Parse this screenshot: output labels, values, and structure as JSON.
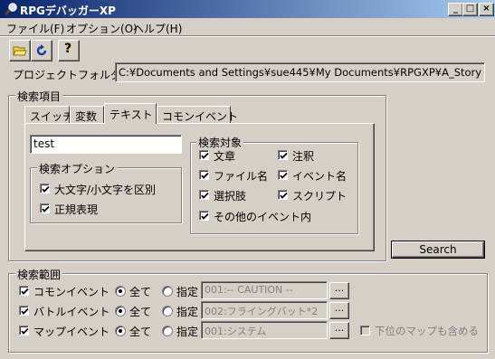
{
  "window": {
    "title": "RPGデバッガーXP",
    "buttons": {
      "minimize": "_",
      "maximize": "□",
      "close": "×"
    }
  },
  "menu": [
    "ファイル(F)",
    "オプション(O)",
    "ヘルプ(H)"
  ],
  "toolbar": {
    "icons": [
      "folder-open-icon",
      "refresh-icon",
      "help-icon"
    ],
    "help_label": "?"
  },
  "project": {
    "label": "プロジェクトフォルダ",
    "path": "C:¥Documents and Settings¥sue445¥My Documents¥RPGXP¥A_Story"
  },
  "search_items": {
    "title": "検索項目",
    "tabs": [
      "スイッチ",
      "変数",
      "テキスト",
      "コモンイベント"
    ],
    "active_tab": "テキスト",
    "query": "test",
    "options": {
      "title": "検索オプション",
      "items": [
        {
          "label": "大文字/小文字を区別",
          "checked": true
        },
        {
          "label": "正規表現",
          "checked": true
        }
      ]
    },
    "targets": {
      "title": "検索対象",
      "items": [
        {
          "label": "文章",
          "checked": true
        },
        {
          "label": "注釈",
          "checked": true
        },
        {
          "label": "ファイル名",
          "checked": true
        },
        {
          "label": "イベント名",
          "checked": true
        },
        {
          "label": "選択肢",
          "checked": true
        },
        {
          "label": "スクリプト",
          "checked": true
        },
        {
          "label": "その他のイベント内",
          "checked": true
        }
      ]
    }
  },
  "search_button": "Search",
  "search_range": {
    "title": "検索範囲",
    "all_label": "全て",
    "specify_label": "指定",
    "browse_label": "...",
    "rows": [
      {
        "label": "コモンイベント",
        "checked": true,
        "mode": "all",
        "value": "001:-- CAUTION --"
      },
      {
        "label": "バトルイベント",
        "checked": true,
        "mode": "all",
        "value": "002:フライングバット*2"
      },
      {
        "label": "マップイベント",
        "checked": true,
        "mode": "all",
        "value": "001:システム"
      }
    ],
    "include_sub": {
      "label": "下位のマップも含める",
      "checked": false
    }
  },
  "colors": {
    "face": "#d4d0c8",
    "title_start": "#0a246a",
    "title_end": "#a6caf0"
  }
}
